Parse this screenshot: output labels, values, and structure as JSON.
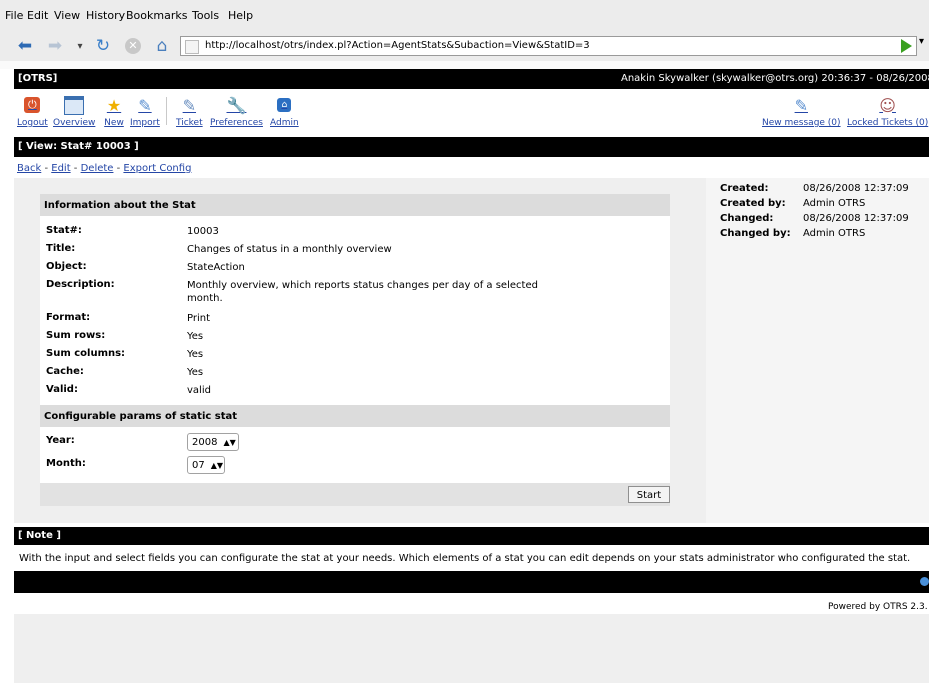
{
  "browser": {
    "menu": [
      "File",
      "Edit",
      "View",
      "History",
      "Bookmarks",
      "Tools",
      "Help"
    ],
    "url": "http://localhost/otrs/index.pl?Action=AgentStats&Subaction=View&StatID=3"
  },
  "header": {
    "brand": "[OTRS]",
    "user_info": "Anakin Skywalker (skywalker@otrs.org) 20:36:37 - 08/26/2008"
  },
  "nav": {
    "items": [
      {
        "label": "Logout",
        "icon": "logout-icon"
      },
      {
        "label": "Overview",
        "icon": "overview-icon"
      },
      {
        "label": "New",
        "icon": "star-icon"
      },
      {
        "label": "Import",
        "icon": "import-icon"
      },
      {
        "label": "Ticket",
        "icon": "ticket-icon"
      },
      {
        "label": "Preferences",
        "icon": "wrench-icon"
      },
      {
        "label": "Admin",
        "icon": "admin-icon"
      }
    ],
    "right": [
      {
        "label": "New message (0)",
        "icon": "message-icon"
      },
      {
        "label": "Locked Tickets (0)",
        "icon": "locked-user-icon"
      }
    ]
  },
  "view_title": "[ View: Stat# 10003 ]",
  "actions": [
    "Back",
    "Edit",
    "Delete",
    "Export Config"
  ],
  "info": {
    "heading": "Information about the Stat",
    "rows": [
      {
        "label": "Stat#:",
        "value": "10003"
      },
      {
        "label": "Title:",
        "value": "Changes of status in a monthly overview"
      },
      {
        "label": "Object:",
        "value": "StateAction"
      },
      {
        "label": "Description:",
        "value": "Monthly overview, which reports status changes per day of a selected month."
      },
      {
        "label": "Format:",
        "value": "Print"
      },
      {
        "label": "Sum rows:",
        "value": "Yes"
      },
      {
        "label": "Sum columns:",
        "value": "Yes"
      },
      {
        "label": "Cache:",
        "value": "Yes"
      },
      {
        "label": "Valid:",
        "value": "valid"
      }
    ]
  },
  "params": {
    "heading": "Configurable params of static stat",
    "year_label": "Year:",
    "year_value": "2008",
    "month_label": "Month:",
    "month_value": "07"
  },
  "start_label": "Start",
  "meta": [
    {
      "label": "Created:",
      "value": "08/26/2008 12:37:09"
    },
    {
      "label": "Created by:",
      "value": "Admin OTRS"
    },
    {
      "label": "Changed:",
      "value": "08/26/2008 12:37:09"
    },
    {
      "label": "Changed by:",
      "value": "Admin OTRS"
    }
  ],
  "note": {
    "heading": "[ Note ]",
    "text": "With the input and select fields you can configurate the stat at your needs. Which elements of a stat you can edit depends on your stats administrator who configurated the stat."
  },
  "footer": "Powered by OTRS 2.3."
}
